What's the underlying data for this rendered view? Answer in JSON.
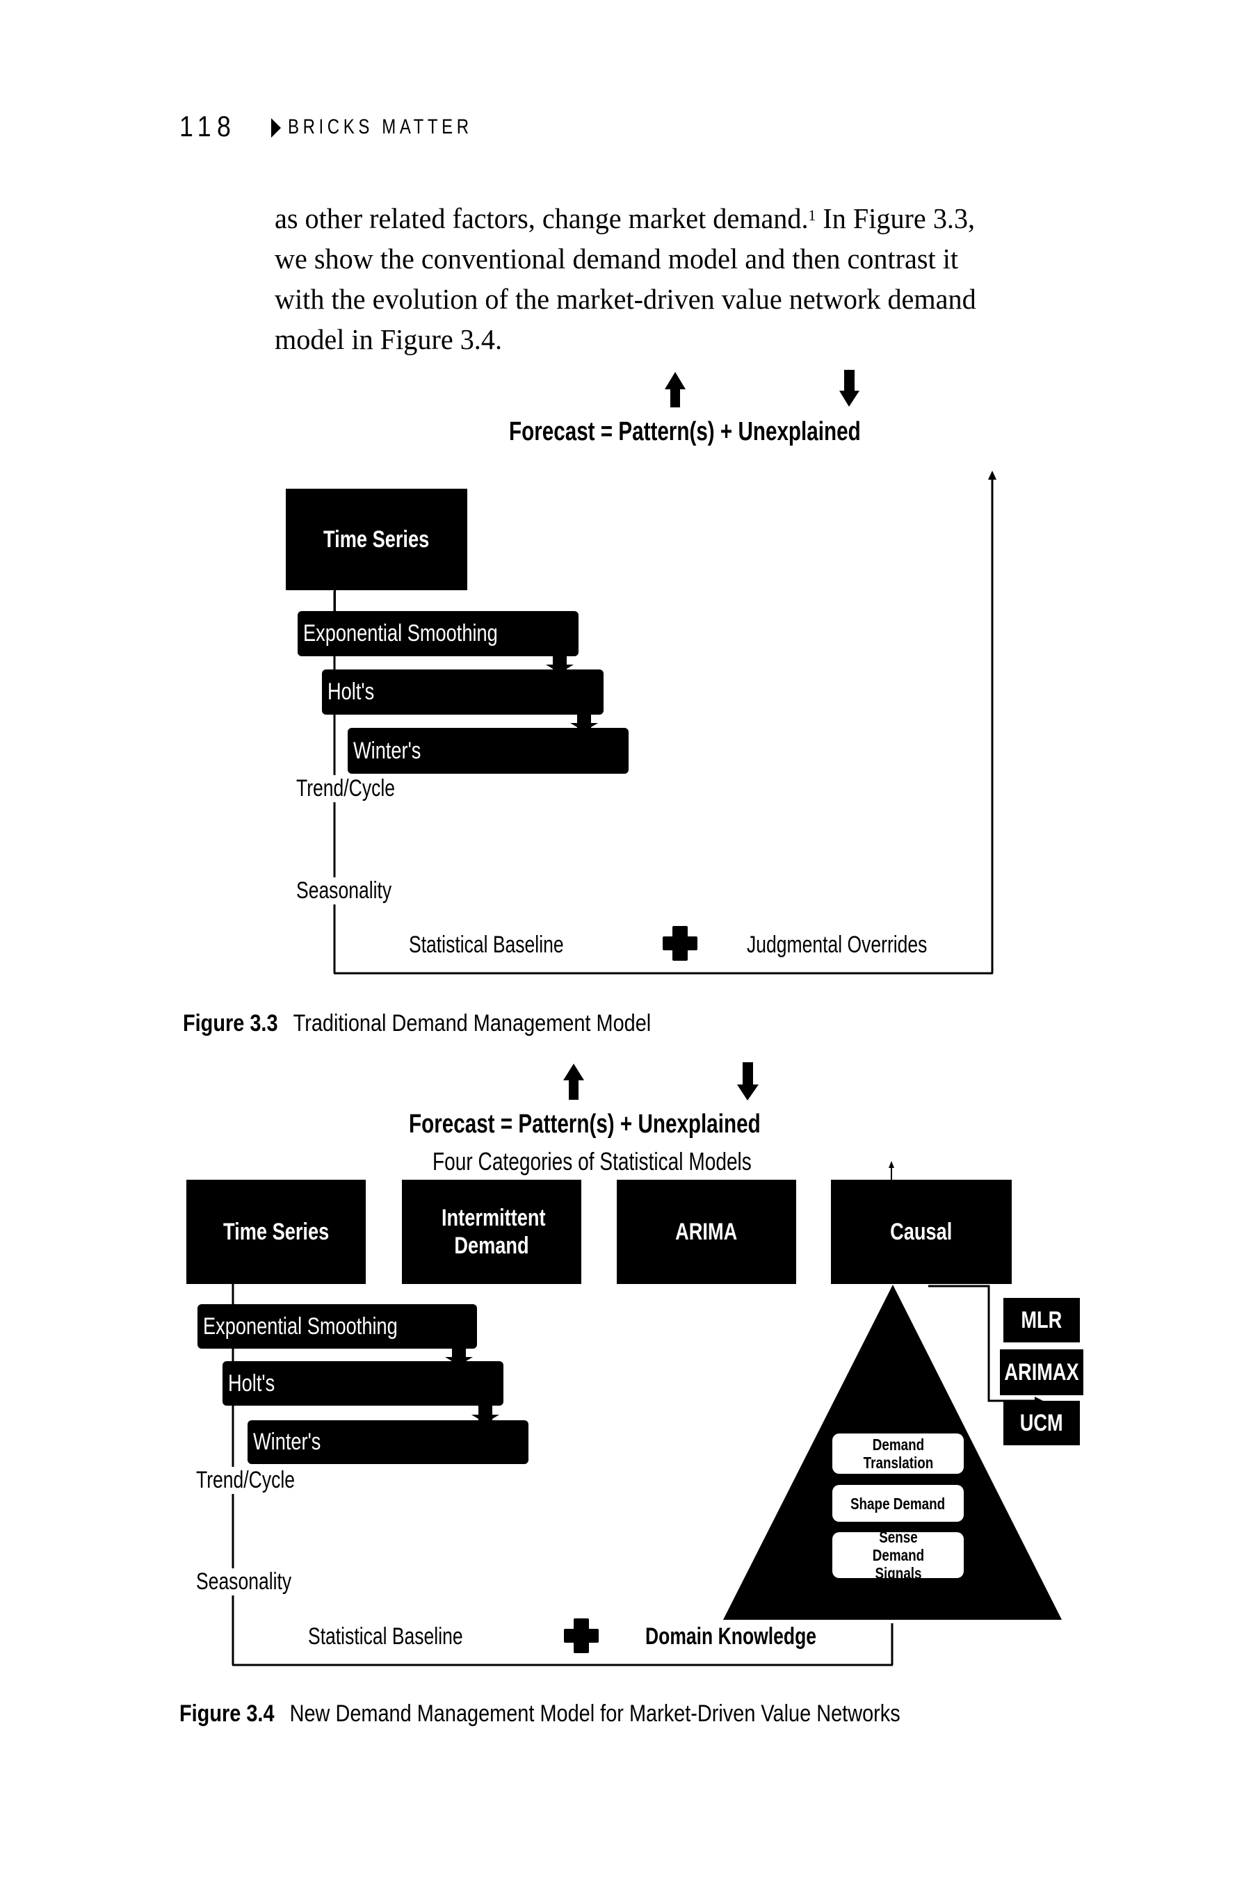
{
  "header": {
    "page_number": "118",
    "marker_icon": "right-triangle-icon",
    "running_title": "BRICKS MATTER"
  },
  "body": {
    "lines": [
      "as other related factors, change market demand.",
      "we show the conventional demand model and then contrast it",
      "with the evolution of the market-driven value network demand",
      "model in Figure 3.4."
    ],
    "footnote_ref": "1",
    "line1_tail": " In Figure 3.3,"
  },
  "figure_3_3": {
    "up_arrow_icon": "up-arrow-icon",
    "down_arrow_icon": "down-arrow-icon",
    "formula": "Forecast = Pattern(s)  +  Unexplained",
    "time_series_box": "Time Series",
    "methods": [
      "Exponential Smoothing",
      "Holt's",
      "Winter's"
    ],
    "trend_cycle": "Trend/Cycle",
    "seasonality": "Seasonality",
    "statistical_baseline": "Statistical Baseline",
    "plus_icon": "plus-icon",
    "judgmental_overrides": "Judgmental Overrides",
    "caption_label": "Figure 3.3",
    "caption_text": "Traditional Demand Management Model"
  },
  "figure_3_4": {
    "formula": "Forecast = Pattern(s)  +  Unexplained",
    "categories_title": "Four Categories of Statistical Models",
    "categories": [
      {
        "label": "Time Series"
      },
      {
        "label": "Intermittent Demand"
      },
      {
        "label": "ARIMA"
      },
      {
        "label": "Causal"
      }
    ],
    "methods": [
      "Exponential Smoothing",
      "Holt's",
      "Winter's"
    ],
    "trend_cycle": "Trend/Cycle",
    "seasonality": "Seasonality",
    "pyramid_steps": [
      "Demand Translation",
      "Shape Demand",
      "Sense Demand Signals"
    ],
    "causal_models": [
      "MLR",
      "ARIMAX",
      "UCM"
    ],
    "statistical_baseline": "Statistical Baseline",
    "domain_knowledge": "Domain Knowledge",
    "caption_label": "Figure 3.4",
    "caption_text": "New Demand Management Model for Market-Driven Value Networks"
  }
}
